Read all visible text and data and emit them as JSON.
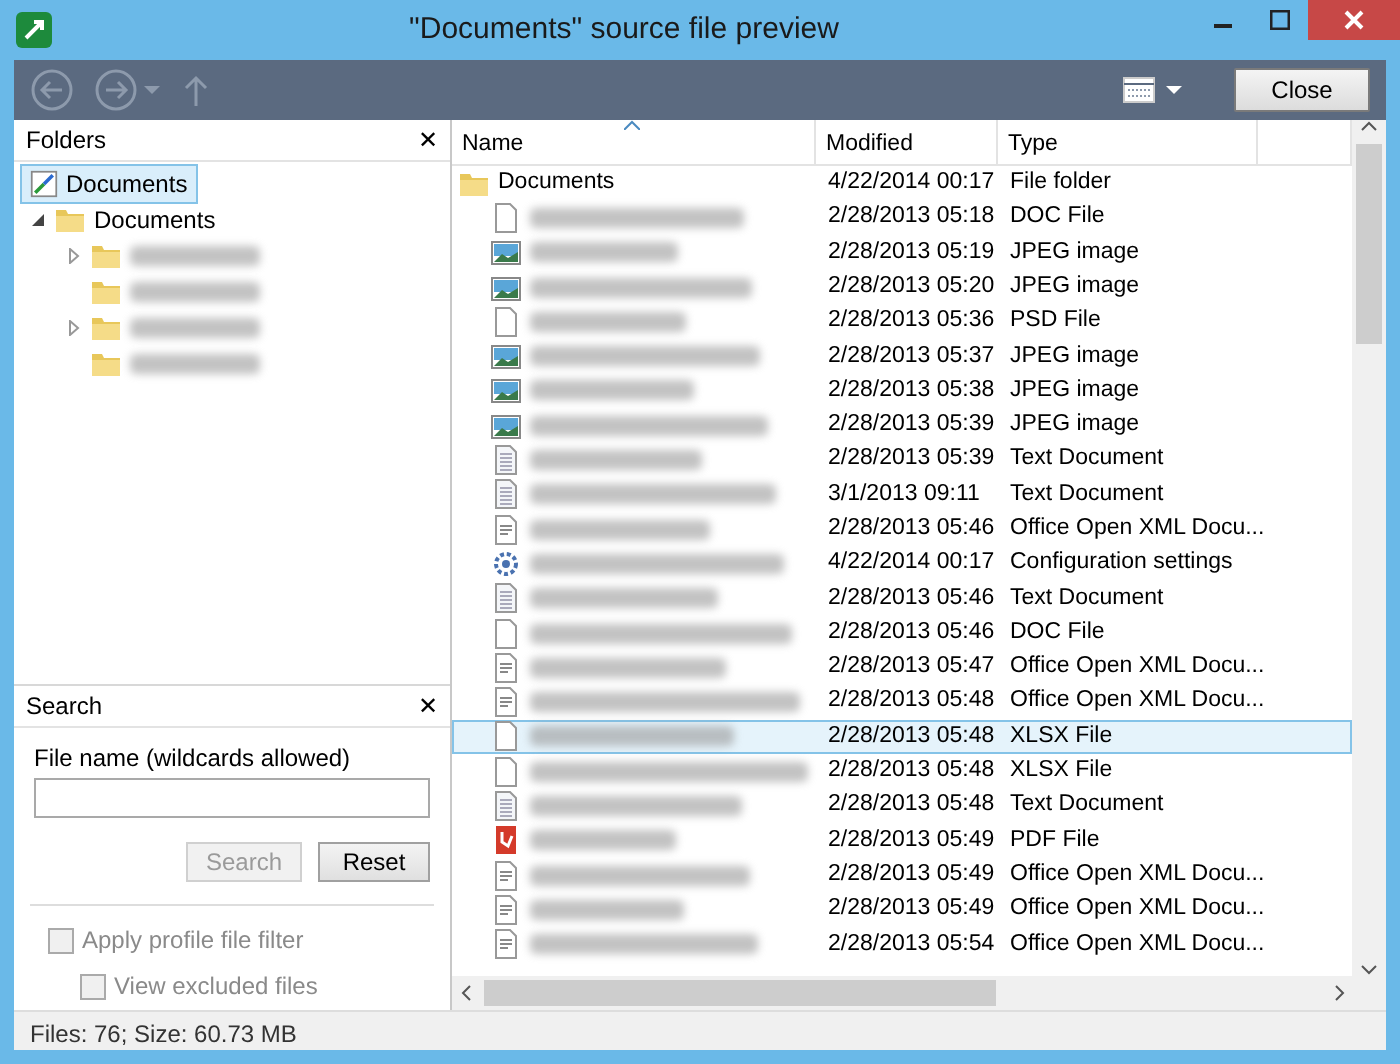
{
  "window": {
    "title": "\"Documents\" source file preview"
  },
  "toolbar": {
    "close_button": "Close"
  },
  "folders": {
    "title": "Folders",
    "close": "✕",
    "root": {
      "label": "Documents",
      "selected": true
    },
    "tree": [
      {
        "label": "Documents",
        "expanded": true,
        "children": [
          {
            "blurred": true,
            "expandable": true
          },
          {
            "blurred": true,
            "expandable": false
          },
          {
            "blurred": true,
            "expandable": true
          },
          {
            "blurred": true,
            "expandable": false
          }
        ]
      }
    ]
  },
  "search": {
    "title": "Search",
    "close": "✕",
    "field_label": "File name (wildcards allowed)",
    "search_button": {
      "label": "Search",
      "disabled": true
    },
    "reset_button": {
      "label": "Reset",
      "disabled": false
    },
    "options": [
      {
        "label": "Apply profile file filter",
        "checked": false,
        "disabled": true,
        "children": [
          {
            "label": "View excluded files",
            "checked": false,
            "disabled": true
          }
        ]
      }
    ]
  },
  "table": {
    "columns": [
      "Name",
      "Modified",
      "Type"
    ],
    "rows": [
      {
        "kind": "folder",
        "name": "Documents",
        "modified": "4/22/2014 00:17",
        "type": "File folder",
        "selected": false
      },
      {
        "kind": "blank",
        "modified": "2/28/2013 05:18",
        "type": "DOC File",
        "selected": false
      },
      {
        "kind": "image",
        "modified": "2/28/2013 05:19",
        "type": "JPEG image",
        "selected": false
      },
      {
        "kind": "image",
        "modified": "2/28/2013 05:20",
        "type": "JPEG image",
        "selected": false
      },
      {
        "kind": "blank",
        "modified": "2/28/2013 05:36",
        "type": "PSD File",
        "selected": false
      },
      {
        "kind": "image",
        "modified": "2/28/2013 05:37",
        "type": "JPEG image",
        "selected": false
      },
      {
        "kind": "image",
        "modified": "2/28/2013 05:38",
        "type": "JPEG image",
        "selected": false
      },
      {
        "kind": "image",
        "modified": "2/28/2013 05:39",
        "type": "JPEG image",
        "selected": false
      },
      {
        "kind": "text",
        "modified": "2/28/2013 05:39",
        "type": "Text Document",
        "selected": false
      },
      {
        "kind": "text",
        "modified": "3/1/2013 09:11",
        "type": "Text Document",
        "selected": false
      },
      {
        "kind": "document",
        "modified": "2/28/2013 05:46",
        "type": "Office Open XML Docu...",
        "selected": false
      },
      {
        "kind": "config",
        "modified": "4/22/2014 00:17",
        "type": "Configuration settings",
        "selected": false
      },
      {
        "kind": "text",
        "modified": "2/28/2013 05:46",
        "type": "Text Document",
        "selected": false
      },
      {
        "kind": "blank",
        "modified": "2/28/2013 05:46",
        "type": "DOC File",
        "selected": false
      },
      {
        "kind": "document",
        "modified": "2/28/2013 05:47",
        "type": "Office Open XML Docu...",
        "selected": false
      },
      {
        "kind": "document",
        "modified": "2/28/2013 05:48",
        "type": "Office Open XML Docu...",
        "selected": false
      },
      {
        "kind": "blank",
        "modified": "2/28/2013 05:48",
        "type": "XLSX File",
        "selected": true
      },
      {
        "kind": "blank",
        "modified": "2/28/2013 05:48",
        "type": "XLSX File",
        "selected": false
      },
      {
        "kind": "text",
        "modified": "2/28/2013 05:48",
        "type": "Text Document",
        "selected": false
      },
      {
        "kind": "pdf",
        "modified": "2/28/2013 05:49",
        "type": "PDF File",
        "selected": false
      },
      {
        "kind": "document",
        "modified": "2/28/2013 05:49",
        "type": "Office Open XML Docu...",
        "selected": false
      },
      {
        "kind": "document",
        "modified": "2/28/2013 05:49",
        "type": "Office Open XML Docu...",
        "selected": false
      },
      {
        "kind": "document",
        "modified": "2/28/2013 05:54",
        "type": "Office Open XML Docu...",
        "selected": false
      }
    ]
  },
  "status_bar": "Files: 76; Size: 60.73 MB"
}
